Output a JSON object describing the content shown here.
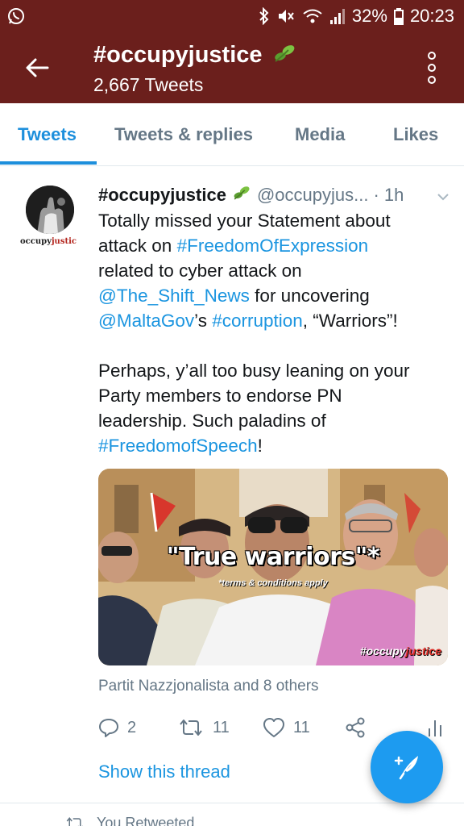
{
  "status_bar": {
    "app_icon": "whatsapp-icon",
    "icons": [
      "bluetooth-icon",
      "mute-icon",
      "wifi-icon",
      "signal-icon"
    ],
    "battery": "32%",
    "time": "20:23"
  },
  "header": {
    "title": "#occupyjustice",
    "title_emoji": "seedling-icon",
    "tweet_count": "2,667 Tweets",
    "color": "#6b1f1c"
  },
  "tabs": [
    {
      "label": "Tweets",
      "active": true
    },
    {
      "label": "Tweets & replies",
      "active": false
    },
    {
      "label": "Media",
      "active": false
    },
    {
      "label": "Likes",
      "active": false
    }
  ],
  "tweet": {
    "avatar_caption_part1": "occupy",
    "avatar_caption_part2": "justic",
    "name": "#occupyjustice",
    "handle": "@occupyjus...",
    "time": "· 1h",
    "body": {
      "l1a": "Totally missed your Statement about",
      "l2a": "attack on ",
      "l2b": "#FreedomOfExpression",
      "l3a": "related to cyber attack on",
      "l4a": "@The_Shift_News",
      "l4b": " for uncovering",
      "l5a": "@MaltaGov",
      "l5b": "’s ",
      "l5c": "#corruption",
      "l5d": ", “Warriors”!",
      "l7a": "Perhaps, y’all too busy leaning on your",
      "l8a": "Party members to endorse PN",
      "l9a": "leadership. Such paladins of",
      "l10a": "#FreedomofSpeech",
      "l10b": "!"
    },
    "media": {
      "caption_main": "\"True warriors\"*",
      "caption_sub": "*terms & conditions apply",
      "watermark_1": "#occupy",
      "watermark_2": "justice"
    },
    "tagged": "Partit Nazzjonalista and 8 others",
    "actions": {
      "reply_count": "2",
      "retweet_count": "11",
      "like_count": "11"
    },
    "show_thread": "Show this thread"
  },
  "next_item": {
    "retweet_label": "You Retweeted"
  },
  "colors": {
    "accent": "#1d9bf0",
    "link": "#1b95e0",
    "muted": "#657786"
  }
}
